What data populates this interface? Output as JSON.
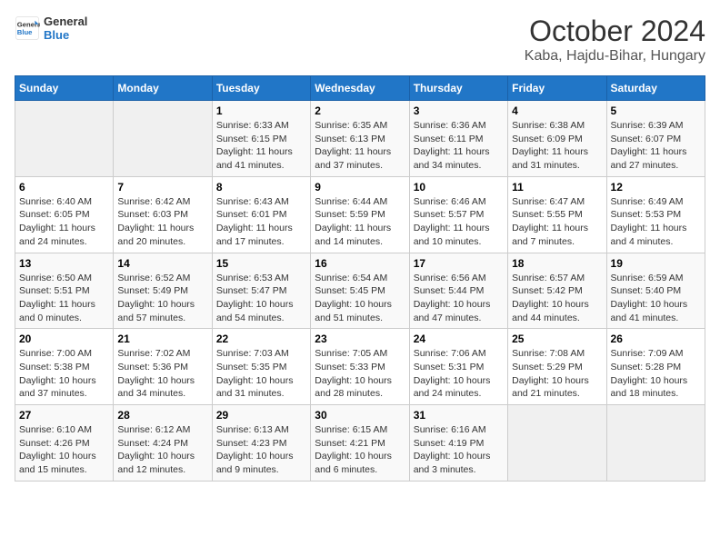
{
  "header": {
    "logo_line1": "General",
    "logo_line2": "Blue",
    "month": "October 2024",
    "location": "Kaba, Hajdu-Bihar, Hungary"
  },
  "weekdays": [
    "Sunday",
    "Monday",
    "Tuesday",
    "Wednesday",
    "Thursday",
    "Friday",
    "Saturday"
  ],
  "weeks": [
    [
      {
        "day": "",
        "sunrise": "",
        "sunset": "",
        "daylight": ""
      },
      {
        "day": "",
        "sunrise": "",
        "sunset": "",
        "daylight": ""
      },
      {
        "day": "1",
        "sunrise": "Sunrise: 6:33 AM",
        "sunset": "Sunset: 6:15 PM",
        "daylight": "Daylight: 11 hours and 41 minutes."
      },
      {
        "day": "2",
        "sunrise": "Sunrise: 6:35 AM",
        "sunset": "Sunset: 6:13 PM",
        "daylight": "Daylight: 11 hours and 37 minutes."
      },
      {
        "day": "3",
        "sunrise": "Sunrise: 6:36 AM",
        "sunset": "Sunset: 6:11 PM",
        "daylight": "Daylight: 11 hours and 34 minutes."
      },
      {
        "day": "4",
        "sunrise": "Sunrise: 6:38 AM",
        "sunset": "Sunset: 6:09 PM",
        "daylight": "Daylight: 11 hours and 31 minutes."
      },
      {
        "day": "5",
        "sunrise": "Sunrise: 6:39 AM",
        "sunset": "Sunset: 6:07 PM",
        "daylight": "Daylight: 11 hours and 27 minutes."
      }
    ],
    [
      {
        "day": "6",
        "sunrise": "Sunrise: 6:40 AM",
        "sunset": "Sunset: 6:05 PM",
        "daylight": "Daylight: 11 hours and 24 minutes."
      },
      {
        "day": "7",
        "sunrise": "Sunrise: 6:42 AM",
        "sunset": "Sunset: 6:03 PM",
        "daylight": "Daylight: 11 hours and 20 minutes."
      },
      {
        "day": "8",
        "sunrise": "Sunrise: 6:43 AM",
        "sunset": "Sunset: 6:01 PM",
        "daylight": "Daylight: 11 hours and 17 minutes."
      },
      {
        "day": "9",
        "sunrise": "Sunrise: 6:44 AM",
        "sunset": "Sunset: 5:59 PM",
        "daylight": "Daylight: 11 hours and 14 minutes."
      },
      {
        "day": "10",
        "sunrise": "Sunrise: 6:46 AM",
        "sunset": "Sunset: 5:57 PM",
        "daylight": "Daylight: 11 hours and 10 minutes."
      },
      {
        "day": "11",
        "sunrise": "Sunrise: 6:47 AM",
        "sunset": "Sunset: 5:55 PM",
        "daylight": "Daylight: 11 hours and 7 minutes."
      },
      {
        "day": "12",
        "sunrise": "Sunrise: 6:49 AM",
        "sunset": "Sunset: 5:53 PM",
        "daylight": "Daylight: 11 hours and 4 minutes."
      }
    ],
    [
      {
        "day": "13",
        "sunrise": "Sunrise: 6:50 AM",
        "sunset": "Sunset: 5:51 PM",
        "daylight": "Daylight: 11 hours and 0 minutes."
      },
      {
        "day": "14",
        "sunrise": "Sunrise: 6:52 AM",
        "sunset": "Sunset: 5:49 PM",
        "daylight": "Daylight: 10 hours and 57 minutes."
      },
      {
        "day": "15",
        "sunrise": "Sunrise: 6:53 AM",
        "sunset": "Sunset: 5:47 PM",
        "daylight": "Daylight: 10 hours and 54 minutes."
      },
      {
        "day": "16",
        "sunrise": "Sunrise: 6:54 AM",
        "sunset": "Sunset: 5:45 PM",
        "daylight": "Daylight: 10 hours and 51 minutes."
      },
      {
        "day": "17",
        "sunrise": "Sunrise: 6:56 AM",
        "sunset": "Sunset: 5:44 PM",
        "daylight": "Daylight: 10 hours and 47 minutes."
      },
      {
        "day": "18",
        "sunrise": "Sunrise: 6:57 AM",
        "sunset": "Sunset: 5:42 PM",
        "daylight": "Daylight: 10 hours and 44 minutes."
      },
      {
        "day": "19",
        "sunrise": "Sunrise: 6:59 AM",
        "sunset": "Sunset: 5:40 PM",
        "daylight": "Daylight: 10 hours and 41 minutes."
      }
    ],
    [
      {
        "day": "20",
        "sunrise": "Sunrise: 7:00 AM",
        "sunset": "Sunset: 5:38 PM",
        "daylight": "Daylight: 10 hours and 37 minutes."
      },
      {
        "day": "21",
        "sunrise": "Sunrise: 7:02 AM",
        "sunset": "Sunset: 5:36 PM",
        "daylight": "Daylight: 10 hours and 34 minutes."
      },
      {
        "day": "22",
        "sunrise": "Sunrise: 7:03 AM",
        "sunset": "Sunset: 5:35 PM",
        "daylight": "Daylight: 10 hours and 31 minutes."
      },
      {
        "day": "23",
        "sunrise": "Sunrise: 7:05 AM",
        "sunset": "Sunset: 5:33 PM",
        "daylight": "Daylight: 10 hours and 28 minutes."
      },
      {
        "day": "24",
        "sunrise": "Sunrise: 7:06 AM",
        "sunset": "Sunset: 5:31 PM",
        "daylight": "Daylight: 10 hours and 24 minutes."
      },
      {
        "day": "25",
        "sunrise": "Sunrise: 7:08 AM",
        "sunset": "Sunset: 5:29 PM",
        "daylight": "Daylight: 10 hours and 21 minutes."
      },
      {
        "day": "26",
        "sunrise": "Sunrise: 7:09 AM",
        "sunset": "Sunset: 5:28 PM",
        "daylight": "Daylight: 10 hours and 18 minutes."
      }
    ],
    [
      {
        "day": "27",
        "sunrise": "Sunrise: 6:10 AM",
        "sunset": "Sunset: 4:26 PM",
        "daylight": "Daylight: 10 hours and 15 minutes."
      },
      {
        "day": "28",
        "sunrise": "Sunrise: 6:12 AM",
        "sunset": "Sunset: 4:24 PM",
        "daylight": "Daylight: 10 hours and 12 minutes."
      },
      {
        "day": "29",
        "sunrise": "Sunrise: 6:13 AM",
        "sunset": "Sunset: 4:23 PM",
        "daylight": "Daylight: 10 hours and 9 minutes."
      },
      {
        "day": "30",
        "sunrise": "Sunrise: 6:15 AM",
        "sunset": "Sunset: 4:21 PM",
        "daylight": "Daylight: 10 hours and 6 minutes."
      },
      {
        "day": "31",
        "sunrise": "Sunrise: 6:16 AM",
        "sunset": "Sunset: 4:19 PM",
        "daylight": "Daylight: 10 hours and 3 minutes."
      },
      {
        "day": "",
        "sunrise": "",
        "sunset": "",
        "daylight": ""
      },
      {
        "day": "",
        "sunrise": "",
        "sunset": "",
        "daylight": ""
      }
    ]
  ]
}
